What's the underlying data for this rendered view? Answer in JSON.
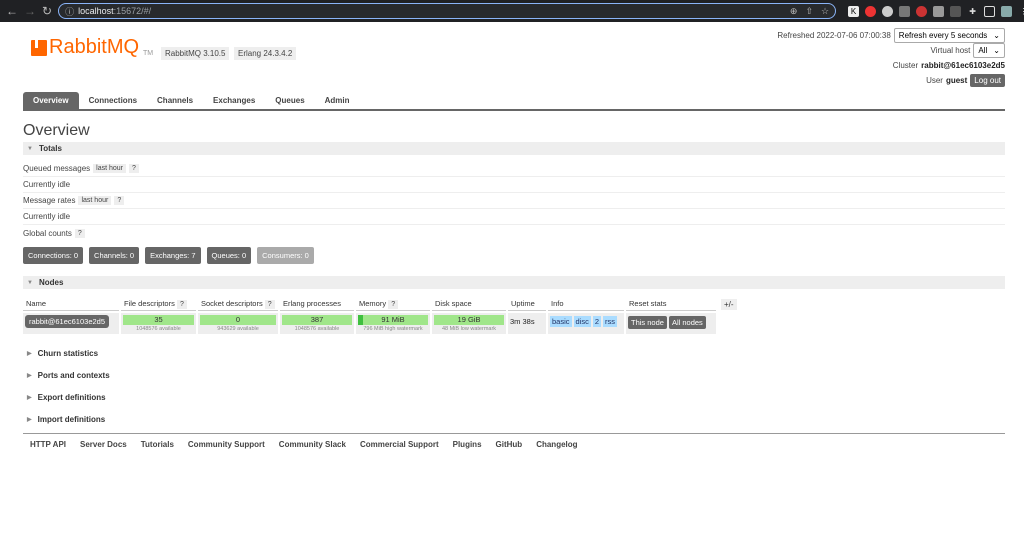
{
  "browser": {
    "url_host": "localhost",
    "url_path": ":15672/#/"
  },
  "header": {
    "logo": "RabbitMQ",
    "logo_tm": "TM",
    "rabbitmq_version": "RabbitMQ 3.10.5",
    "erlang_version": "Erlang 24.3.4.2",
    "refreshed_label": "Refreshed 2022-07-06 07:00:38",
    "refresh_select": "Refresh every 5 seconds",
    "vhost_label": "Virtual host",
    "vhost_select": "All",
    "cluster_label": "Cluster",
    "cluster_name": "rabbit@61ec6103e2d5",
    "user_label": "User",
    "user_name": "guest",
    "logout": "Log out"
  },
  "tabs": [
    "Overview",
    "Connections",
    "Channels",
    "Exchanges",
    "Queues",
    "Admin"
  ],
  "page_title": "Overview",
  "totals": {
    "title": "Totals",
    "queued_messages": "Queued messages",
    "last_hour": "last hour",
    "q": "?",
    "currently_idle": "Currently idle",
    "message_rates": "Message rates",
    "global_counts": "Global counts"
  },
  "counts": {
    "connections": "Connections: 0",
    "channels": "Channels: 0",
    "exchanges": "Exchanges: 7",
    "queues": "Queues: 0",
    "consumers": "Consumers: 0"
  },
  "nodes": {
    "title": "Nodes",
    "headers": {
      "name": "Name",
      "fd": "File descriptors",
      "sd": "Socket descriptors",
      "ep": "Erlang processes",
      "mem": "Memory",
      "disk": "Disk space",
      "uptime": "Uptime",
      "info": "Info",
      "reset": "Reset stats"
    },
    "plus_minus": "+/-",
    "row": {
      "name": "rabbit@61ec6103e2d5",
      "fd": "35",
      "fd_sub": "1048576 available",
      "sd": "0",
      "sd_sub": "943629 available",
      "ep": "387",
      "ep_sub": "1048576 available",
      "mem": "91 MiB",
      "mem_sub": "796 MiB high watermark",
      "disk": "19 GiB",
      "disk_sub": "48 MiB low watermark",
      "uptime": "3m 38s",
      "info_basic": "basic",
      "info_disc": "disc",
      "info_2": "2",
      "info_rss": "rss",
      "this_node": "This node",
      "all_nodes": "All nodes"
    }
  },
  "collapsed_sections": [
    "Churn statistics",
    "Ports and contexts",
    "Export definitions",
    "Import definitions"
  ],
  "footer": [
    "HTTP API",
    "Server Docs",
    "Tutorials",
    "Community Support",
    "Community Slack",
    "Commercial Support",
    "Plugins",
    "GitHub",
    "Changelog"
  ]
}
